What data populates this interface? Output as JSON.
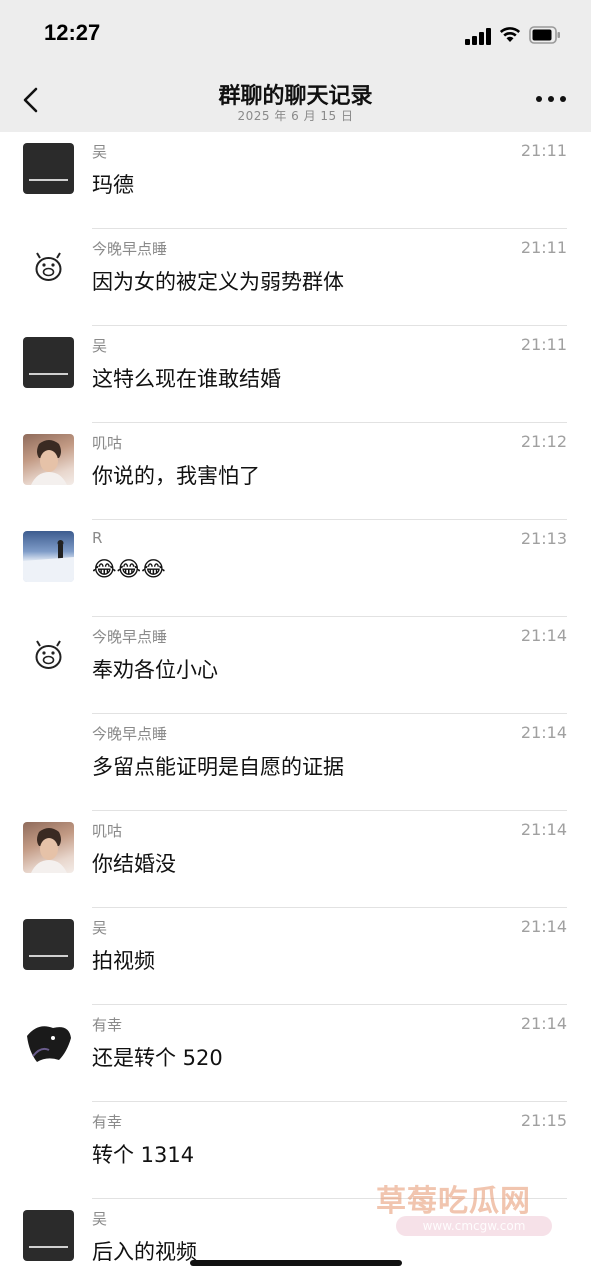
{
  "status_bar": {
    "time": "12:27"
  },
  "header": {
    "title": "群聊的聊天记录",
    "subtitle": "2025 年 6 月 15 日"
  },
  "messages": [
    {
      "sender": "吴",
      "time": "21:11",
      "text": "玛德",
      "avatar": "dark"
    },
    {
      "sender": "今晚早点睡",
      "time": "21:11",
      "text": "因为女的被定义为弱势群体",
      "avatar": "pig"
    },
    {
      "sender": "吴",
      "time": "21:11",
      "text": "这特么现在谁敢结婚",
      "avatar": "dark"
    },
    {
      "sender": "叽咕",
      "time": "21:12",
      "text": "你说的，我害怕了",
      "avatar": "man"
    },
    {
      "sender": "R",
      "time": "21:13",
      "text": "😂😂😂",
      "avatar": "snow"
    },
    {
      "sender": "今晚早点睡",
      "time": "21:14",
      "text": "奉劝各位小心",
      "avatar": "pig"
    },
    {
      "sender": "今晚早点睡",
      "time": "21:14",
      "text": "多留点能证明是自愿的证据",
      "avatar": "none"
    },
    {
      "sender": "叽咕",
      "time": "21:14",
      "text": "你结婚没",
      "avatar": "man"
    },
    {
      "sender": "吴",
      "time": "21:14",
      "text": "拍视频",
      "avatar": "dark"
    },
    {
      "sender": "有幸",
      "time": "21:14",
      "text": "还是转个 520",
      "avatar": "art"
    },
    {
      "sender": "有幸",
      "time": "21:15",
      "text": "转个 1314",
      "avatar": "none"
    },
    {
      "sender": "吴",
      "time": "",
      "text": "后入的视频",
      "avatar": "dark"
    }
  ],
  "watermark": {
    "text": "草莓吃瓜网",
    "url": "www.cmcgw.com"
  }
}
